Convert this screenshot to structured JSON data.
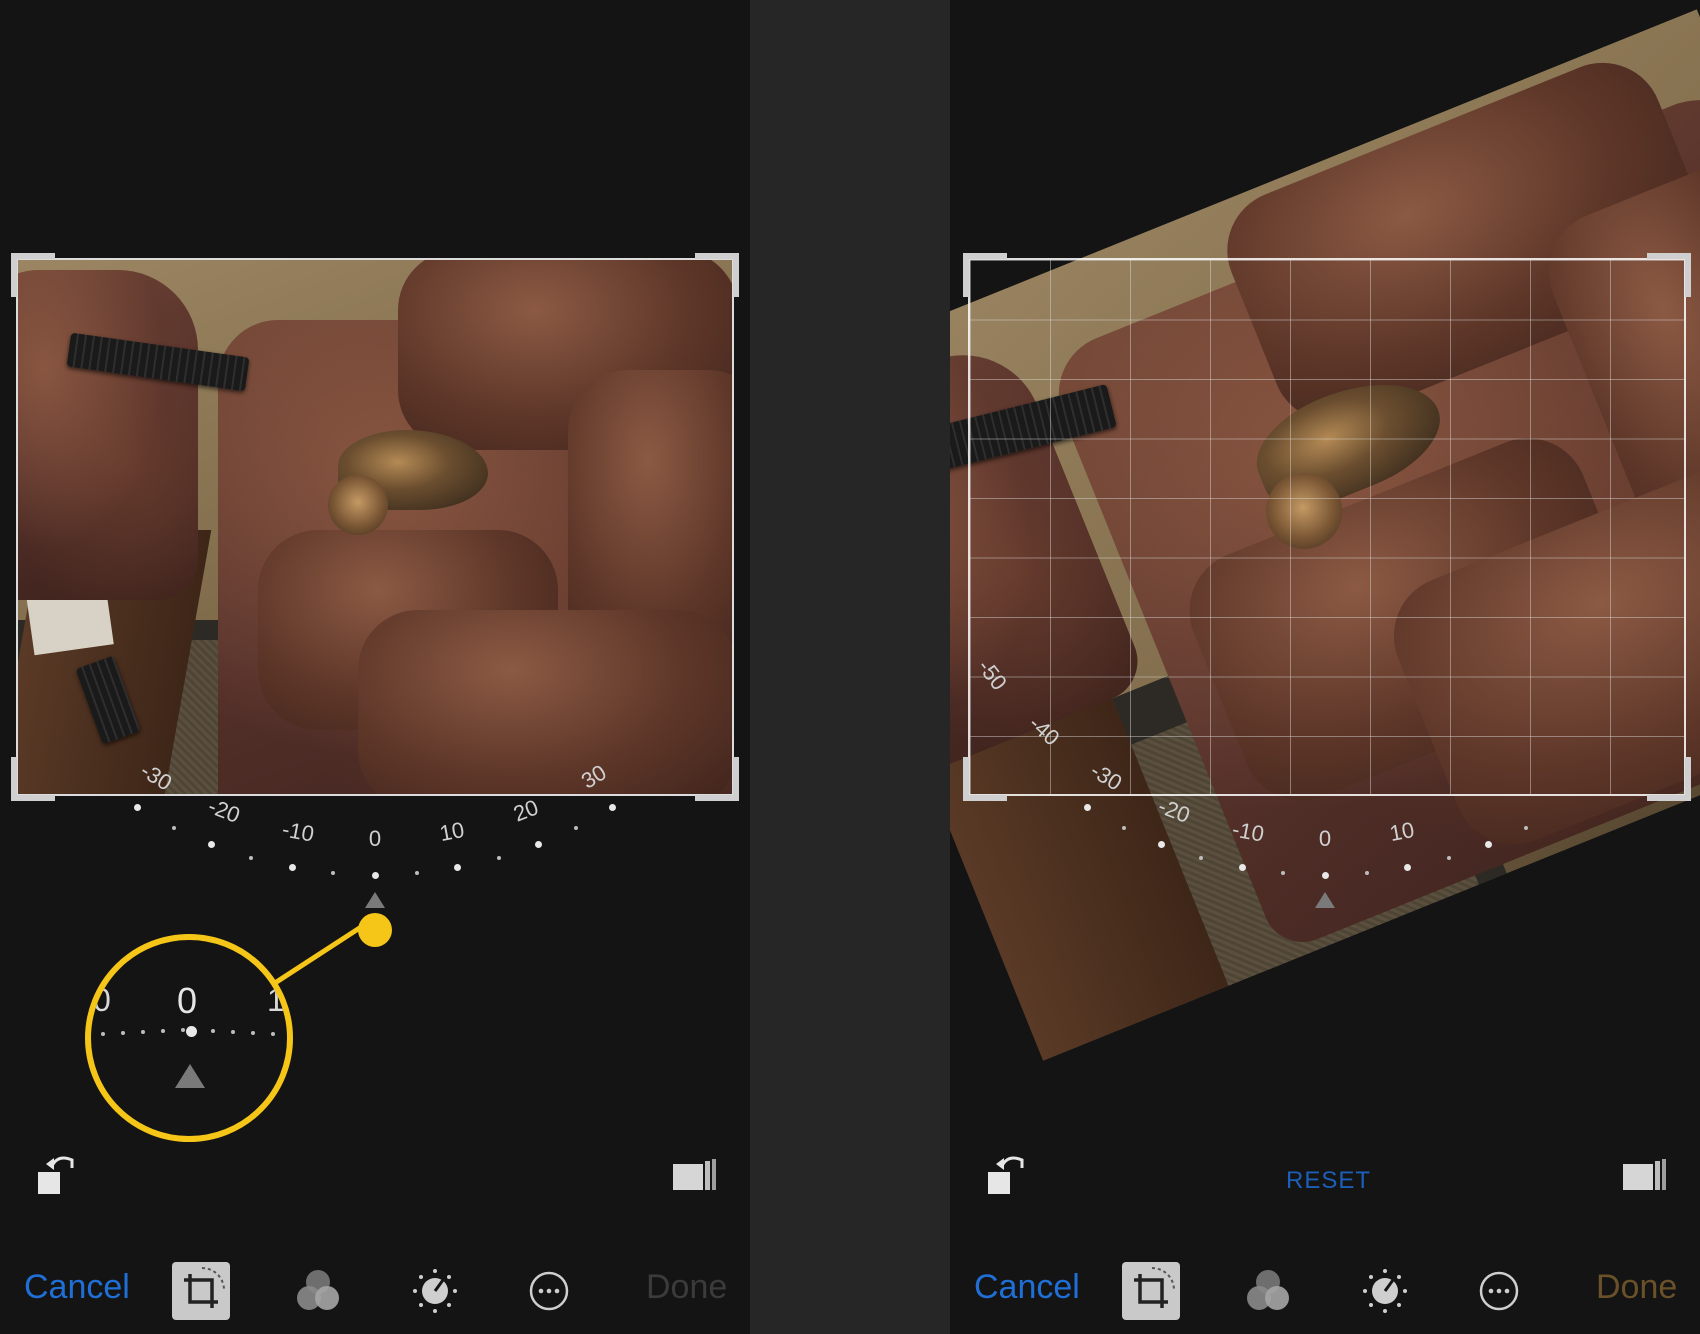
{
  "left_panel": {
    "dial_labels": [
      "-30",
      "-20",
      "-10",
      "0",
      "10",
      "20",
      "30"
    ],
    "zoom_callout": {
      "value": "0",
      "left_partial": "0",
      "right_partial": "1"
    },
    "toolbar": {
      "cancel_label": "Cancel",
      "done_label": "Done"
    }
  },
  "right_panel": {
    "dial_labels": [
      "-50",
      "-40",
      "-30",
      "-20",
      "-10",
      "0",
      "10"
    ],
    "reset_label": "RESET",
    "toolbar": {
      "cancel_label": "Cancel",
      "done_label": "Done"
    }
  },
  "colors": {
    "accent_blue": "#1f6fd6",
    "callout_yellow": "#f5c518",
    "done_enabled": "#6a5129",
    "done_disabled": "#3b3b3b"
  },
  "icons": [
    "rotate-icon",
    "aspect-ratio-icon",
    "crop-rotate-icon",
    "filters-icon",
    "adjust-dial-icon",
    "more-options-icon"
  ]
}
